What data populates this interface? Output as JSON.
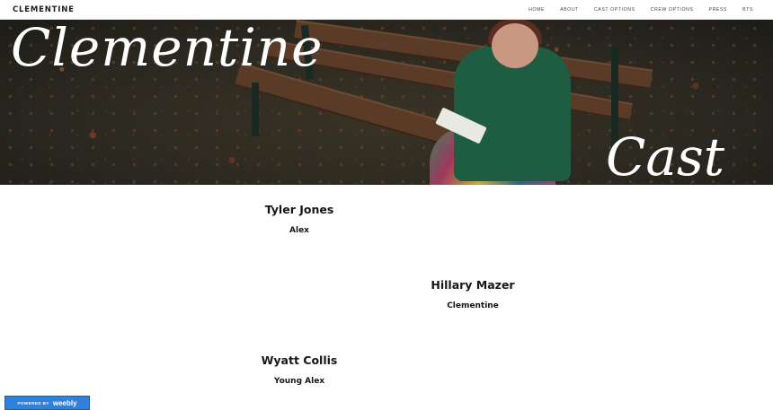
{
  "header": {
    "site_title": "CLEMENTINE",
    "nav": [
      "HOME",
      "ABOUT",
      "CAST OPTIONS",
      "CREW OPTIONS",
      "PRESS",
      "BTS"
    ]
  },
  "banner": {
    "title": "Clementine",
    "subtitle": "Cast"
  },
  "cast": [
    {
      "name": "Tyler Jones",
      "role": "Alex"
    },
    {
      "name": "Hillary Mazer",
      "role": "Clementine"
    },
    {
      "name": "Wyatt Collis",
      "role": "Young Alex"
    }
  ],
  "footer": {
    "powered_by": "POWERED BY",
    "brand": "weebly"
  }
}
